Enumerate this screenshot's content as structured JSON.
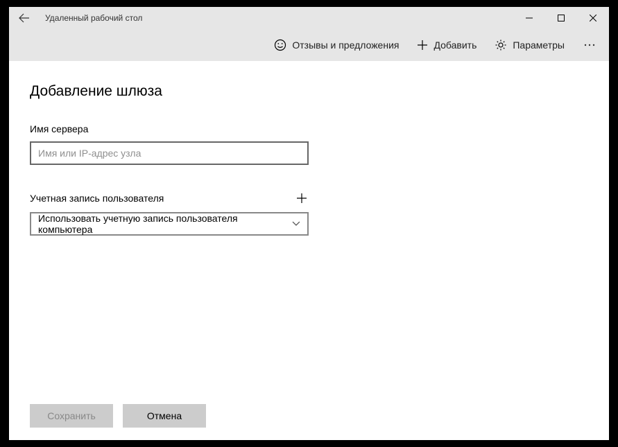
{
  "window": {
    "title": "Удаленный рабочий стол"
  },
  "toolbar": {
    "feedback_label": "Отзывы и предложения",
    "add_label": "Добавить",
    "settings_label": "Параметры"
  },
  "page": {
    "title": "Добавление шлюза",
    "server_label": "Имя сервера",
    "server_placeholder": "Имя или IP-адрес узла",
    "server_value": "",
    "account_label": "Учетная запись пользователя",
    "account_selected": "Использовать учетную запись пользователя компьютера"
  },
  "footer": {
    "save_label": "Сохранить",
    "cancel_label": "Отмена"
  }
}
